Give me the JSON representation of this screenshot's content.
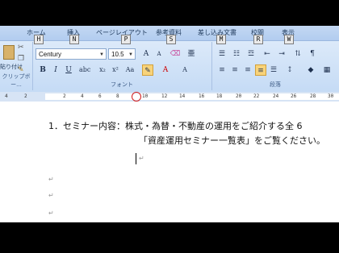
{
  "tabs": {
    "home": "ホーム",
    "insert": "挿入",
    "page_layout": "ページレイアウト",
    "references": "参考資料",
    "mailings": "差し込み文書",
    "review": "校閲",
    "view": "表示"
  },
  "keytips": [
    "H",
    "N",
    "P",
    "S",
    "M",
    "R",
    "W"
  ],
  "clipboard": {
    "paste_label": "貼り付け",
    "group_label": "クリップボー..."
  },
  "font": {
    "name": "Century",
    "size": "10.5",
    "group_label": "フォント",
    "bold": "B",
    "italic": "I",
    "underline": "U",
    "grow": "A",
    "shrink": "A",
    "color_a": "A"
  },
  "paragraph": {
    "group_label": "段落"
  },
  "ruler_numbers": [
    "4",
    "2",
    "2",
    "4",
    "6",
    "8",
    "10",
    "12",
    "14",
    "16",
    "18",
    "20",
    "22",
    "24",
    "26",
    "28",
    "30"
  ],
  "document": {
    "line1": "1．セミナー内容：株式・為替・不動産の運用をご紹介する全 6",
    "line2": "「資産運用セミナー一覧表」をご覧ください。",
    "para_mark": "↵"
  },
  "colors": {
    "ribbon_top": "#e3eefb",
    "highlight_button": "#f8d37a",
    "annotation_circle": "#d21c1c"
  }
}
